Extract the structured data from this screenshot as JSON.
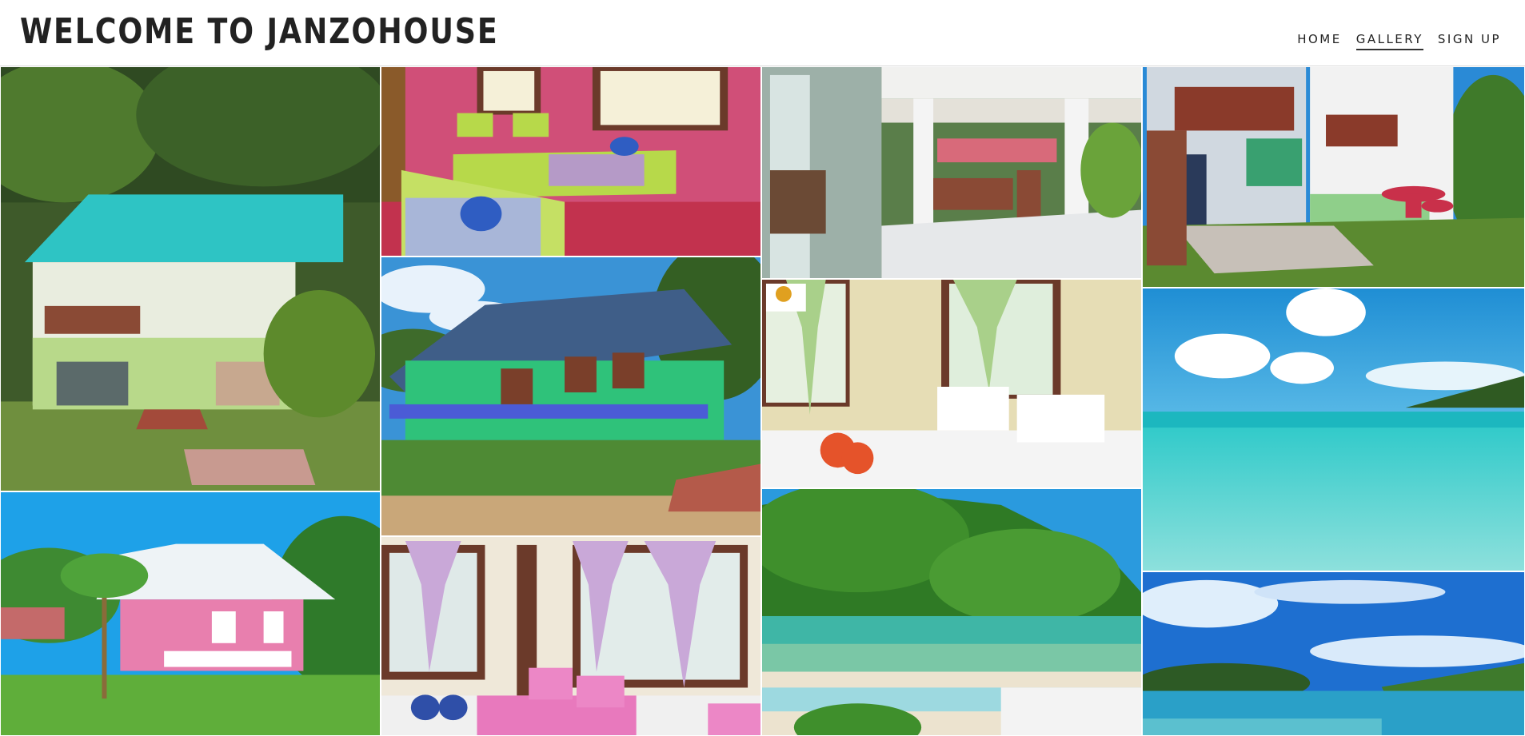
{
  "header": {
    "title": "WELCOME TO JANZOHOUSE",
    "nav": [
      {
        "label": "HOME",
        "active": false
      },
      {
        "label": "GALLERY",
        "active": true
      },
      {
        "label": "SIGN UP",
        "active": false
      }
    ]
  },
  "gallery": {
    "photos": [
      {
        "name": "photo-green-bungalow-turquoise-roof"
      },
      {
        "name": "photo-pink-bedroom-two-beds"
      },
      {
        "name": "photo-white-veranda-gazebo"
      },
      {
        "name": "photo-two-storey-houses-garden"
      },
      {
        "name": "photo-green-house-blue-roof"
      },
      {
        "name": "photo-cream-bedroom-white-bed"
      },
      {
        "name": "photo-underwater-sea-sky"
      },
      {
        "name": "photo-pink-house-palm"
      },
      {
        "name": "photo-bedroom-lilac-curtains"
      },
      {
        "name": "photo-jungle-island-lagoon"
      },
      {
        "name": "photo-bay-islands-blue-sky"
      }
    ]
  },
  "colors": {
    "header_bg": "#ffffff",
    "title_text": "#222222",
    "nav_text": "#222222"
  }
}
